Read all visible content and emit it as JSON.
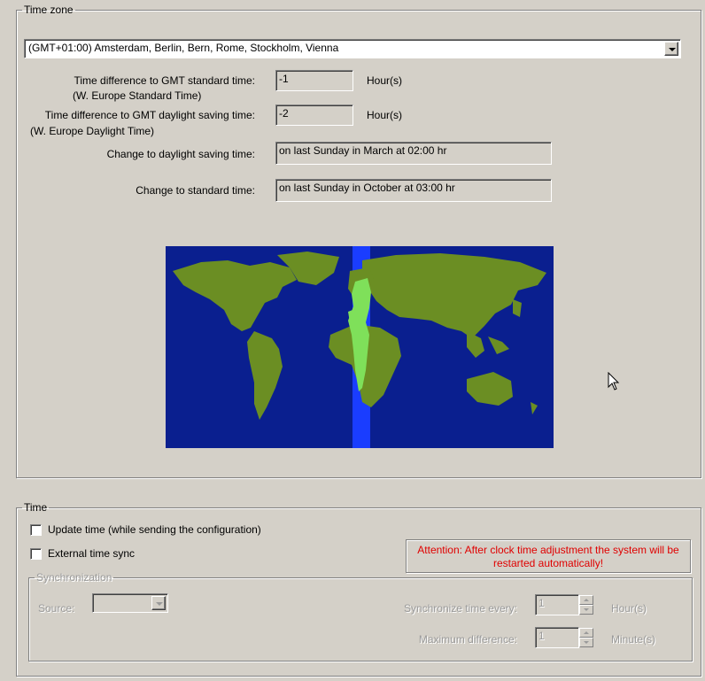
{
  "time_zone_group": {
    "legend": "Time zone",
    "selected_zone": "(GMT+01:00) Amsterdam, Berlin, Bern, Rome, Stockholm, Vienna",
    "standard_diff_label_line1": "Time difference to GMT standard time:",
    "standard_diff_label_line2": "(W. Europe Standard Time)",
    "standard_diff_value": "-1",
    "standard_diff_unit": "Hour(s)",
    "daylight_diff_label_line1": "Time difference to GMT daylight saving time:",
    "daylight_diff_label_line2": "(W. Europe Daylight Time)",
    "daylight_diff_value": "-2",
    "daylight_diff_unit": "Hour(s)",
    "dst_change_label": "Change to daylight saving time:",
    "dst_change_value": "on last Sunday in March at 02:00 hr",
    "std_change_label": "Change to standard time:",
    "std_change_value": "on last Sunday in October at 03:00 hr",
    "map": {
      "ocean_color": "#0a1f8f",
      "land_color": "#6b8e23",
      "highlight_band_color": "#1a3dff",
      "highlight_land_color": "#7fe05a"
    }
  },
  "time_group": {
    "legend": "Time",
    "update_time_label": "Update time (while sending the configuration)",
    "update_time_checked": false,
    "external_sync_label": "External time sync",
    "external_sync_checked": false,
    "attention_text": "Attention: After clock time adjustment the system will be restarted automatically!",
    "attention_color": "#e00000"
  },
  "sync_group": {
    "legend": "Synchronization",
    "source_label": "Source:",
    "source_value": "",
    "sync_every_label": "Synchronize time every:",
    "sync_every_value": "1",
    "sync_every_unit": "Hour(s)",
    "max_diff_label": "Maximum difference:",
    "max_diff_value": "1",
    "max_diff_unit": "Minute(s)"
  }
}
